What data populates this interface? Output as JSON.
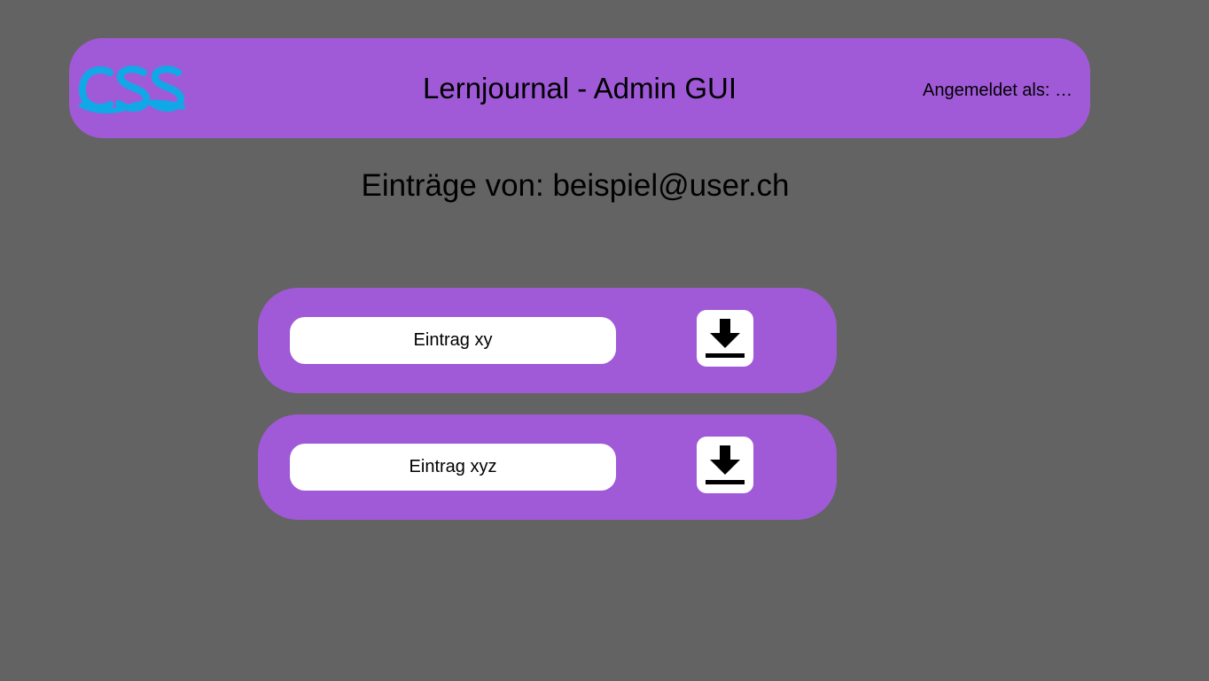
{
  "header": {
    "logo_text": "CSS",
    "logo_color": "#10a8e6",
    "title": "Lernjournal - Admin GUI",
    "user_status": "Angemeldet als: …"
  },
  "main": {
    "heading": "Einträge von: beispiel@user.ch",
    "entries": [
      {
        "label": "Eintrag xy",
        "icon": "download-icon"
      },
      {
        "label": "Eintrag xyz",
        "icon": "download-icon"
      }
    ]
  },
  "colors": {
    "background": "#636363",
    "accent": "#a05ad8",
    "card": "#ffffff"
  }
}
